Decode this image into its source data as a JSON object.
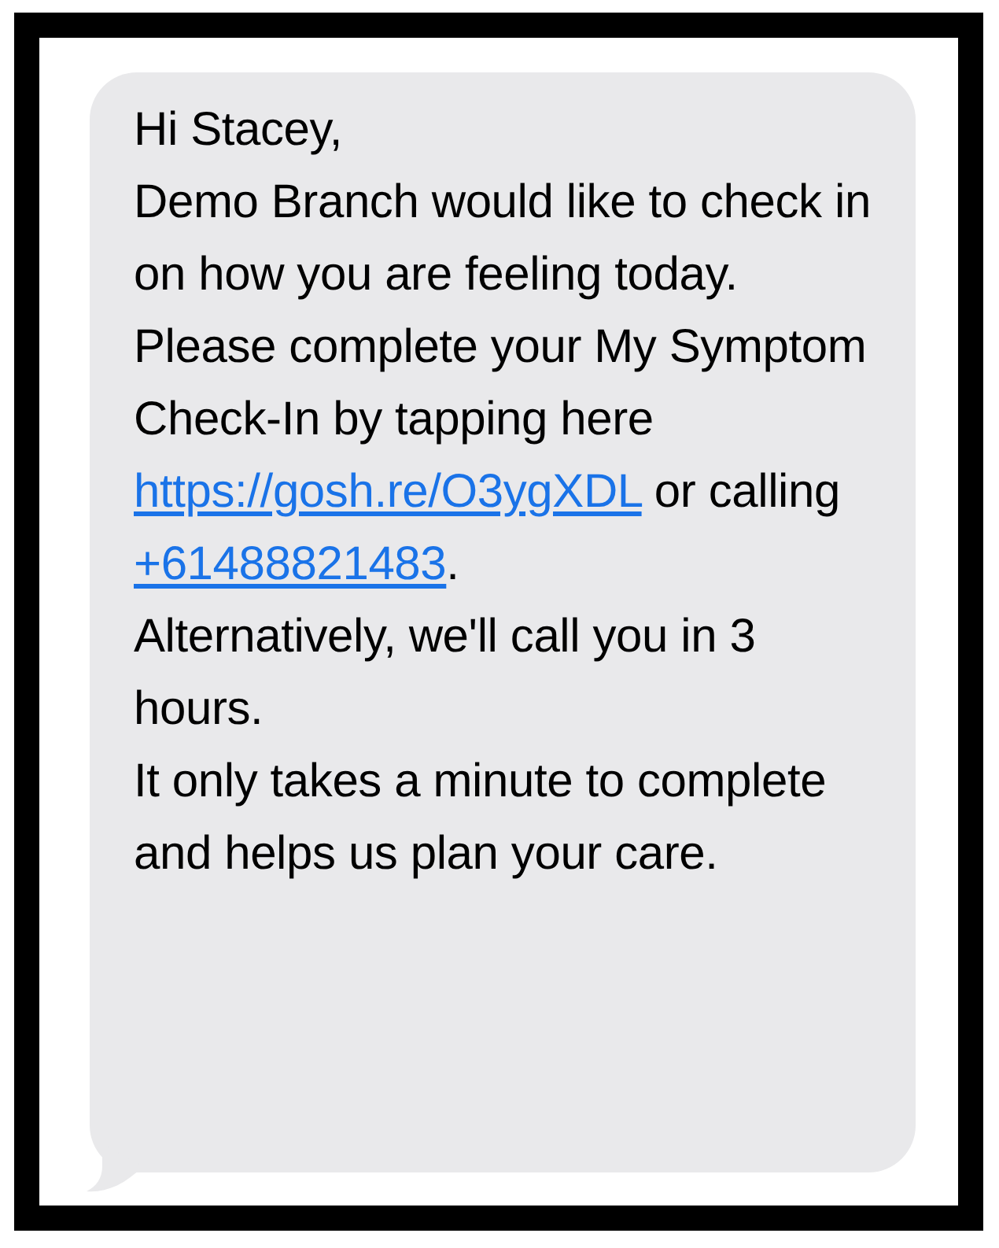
{
  "message": {
    "paragraphs": [
      [
        {
          "kind": "text",
          "text": "Hi Stacey,"
        }
      ],
      [
        {
          "kind": "text",
          "text": "Demo Branch would like to check in on how you are feeling today."
        }
      ],
      [
        {
          "kind": "text",
          "text": "Please complete your My Symptom Check-In by tapping here "
        },
        {
          "kind": "link",
          "text": "https://gosh.re/O3ygXDL"
        },
        {
          "kind": "text",
          "text": " or calling "
        },
        {
          "kind": "phone",
          "text": "+61488821483"
        },
        {
          "kind": "text",
          "text": "."
        }
      ],
      [
        {
          "kind": "text",
          "text": "Alternatively, we'll call you in 3 hours."
        }
      ],
      [
        {
          "kind": "text",
          "text": "It only takes a minute to complete and helps us plan your care."
        }
      ]
    ]
  }
}
